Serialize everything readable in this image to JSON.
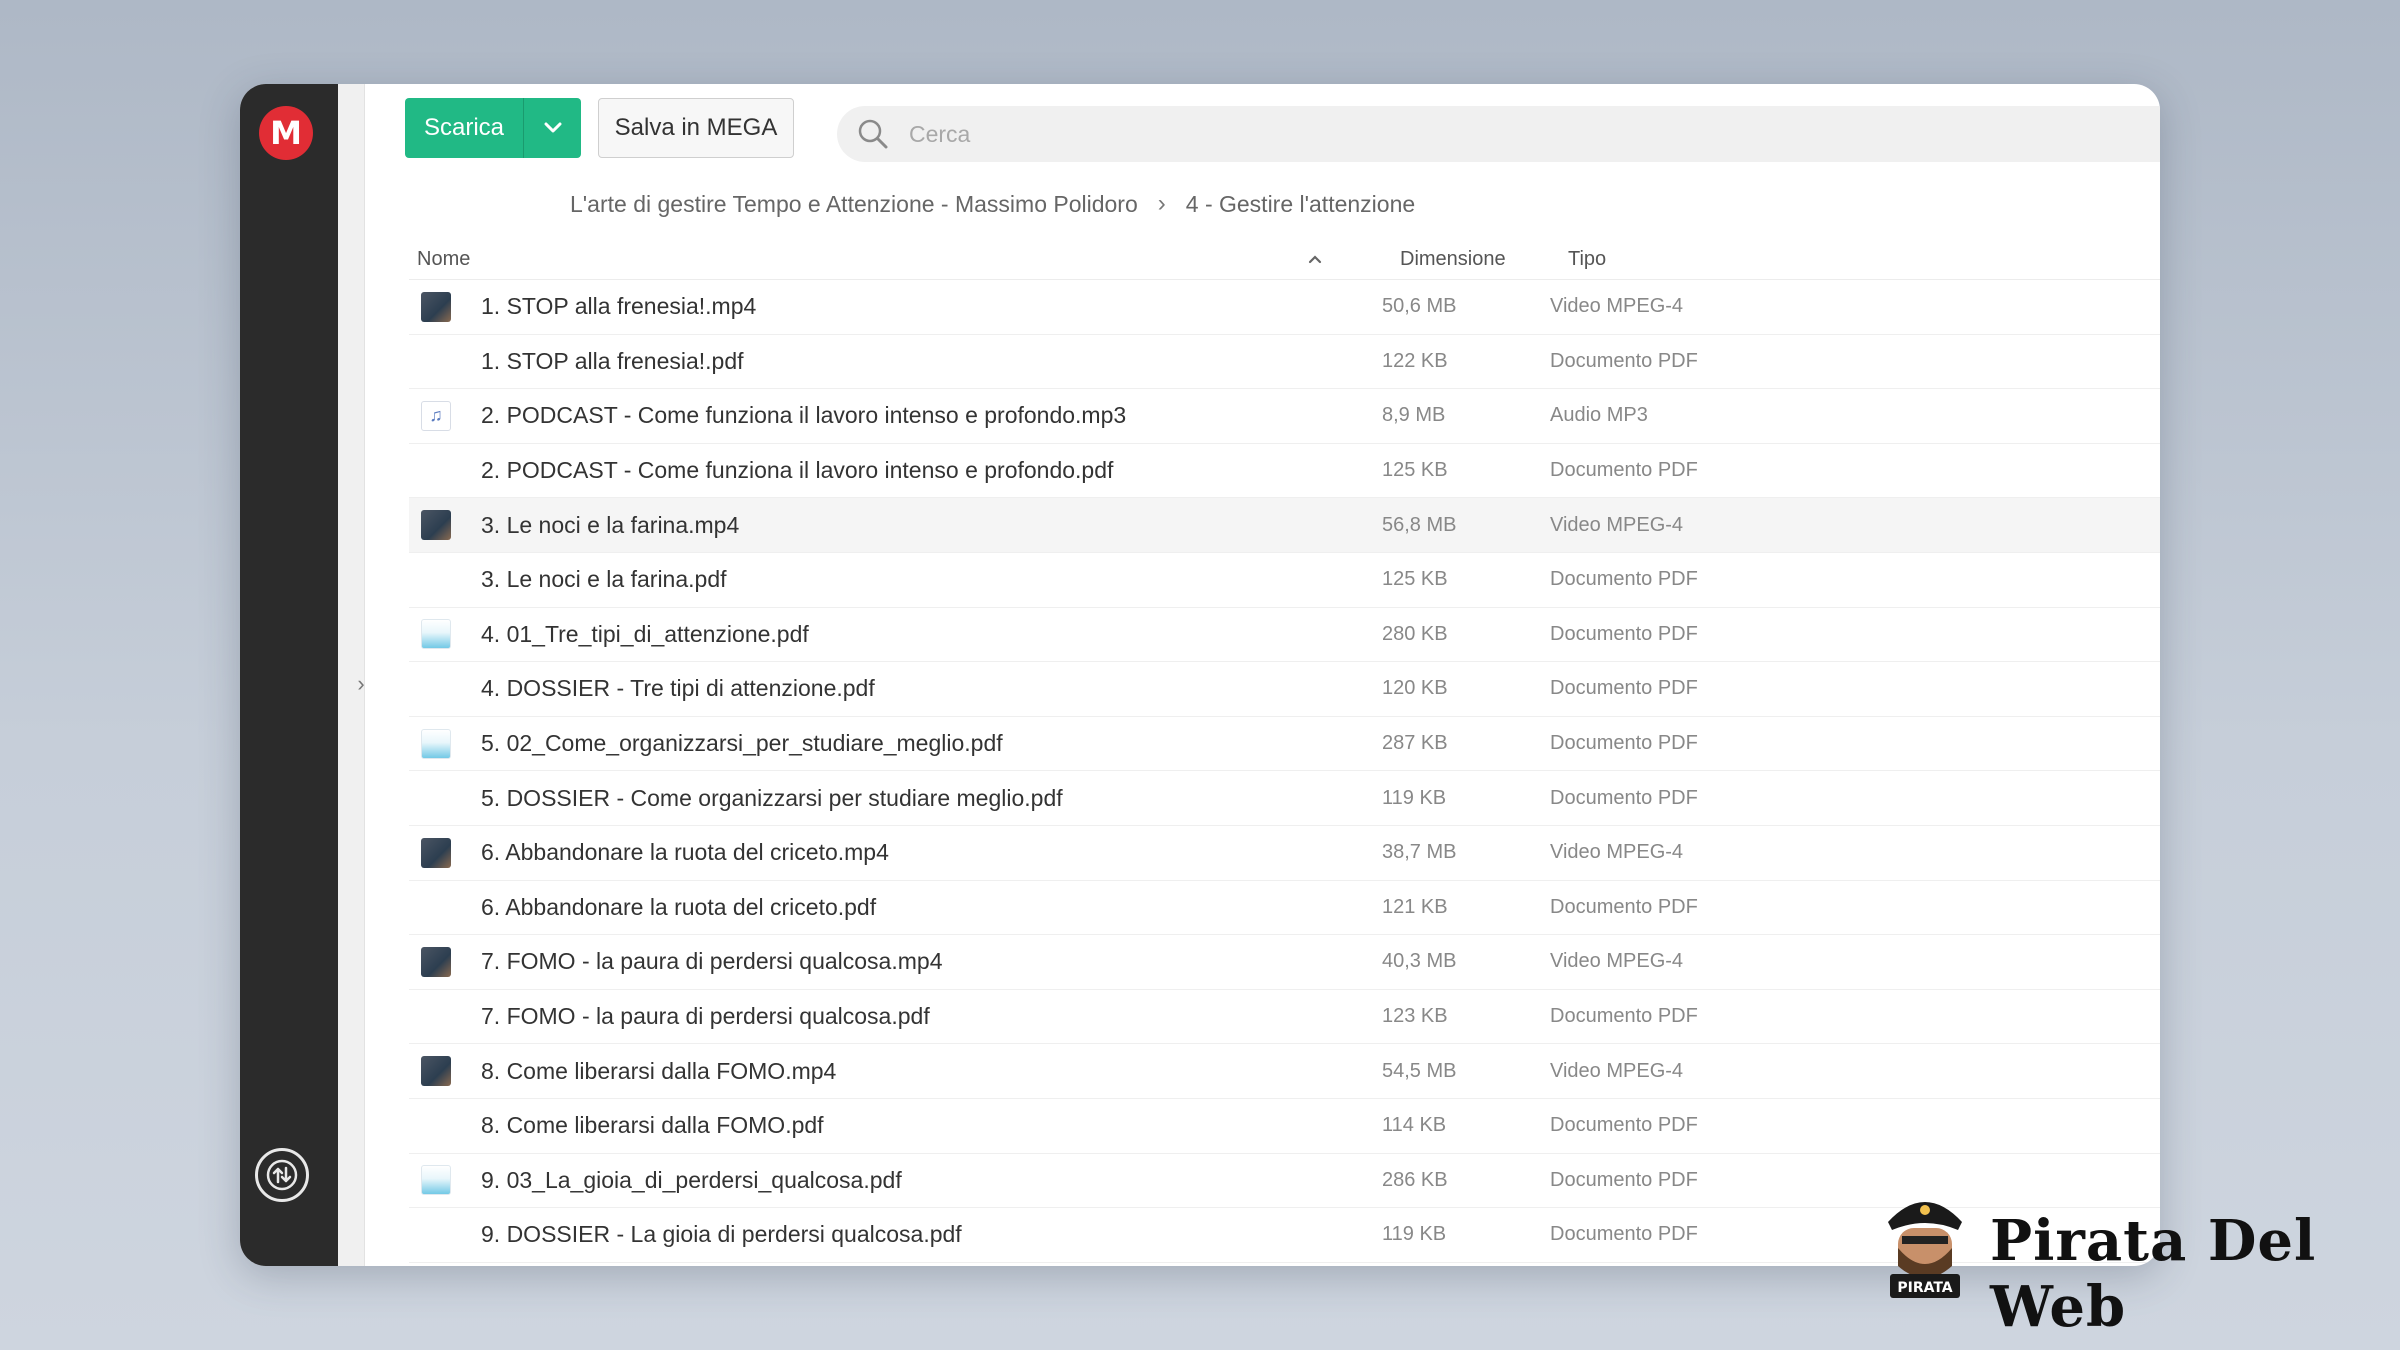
{
  "toolbar": {
    "download_label": "Scarica",
    "save_label": "Salva in MEGA",
    "search_placeholder": "Cerca"
  },
  "breadcrumb": {
    "parent": "L'arte di gestire Tempo e Attenzione - Massimo Polidoro",
    "current": "4 - Gestire l'attenzione"
  },
  "table": {
    "headers": {
      "name": "Nome",
      "size": "Dimensione",
      "type": "Tipo"
    },
    "rows": [
      {
        "name": "1. STOP alla frenesia!.mp4",
        "size": "50,6 MB",
        "type": "Video MPEG-4",
        "thumb": "video"
      },
      {
        "name": "1. STOP alla frenesia!.pdf",
        "size": "122 KB",
        "type": "Documento PDF",
        "thumb": "blank"
      },
      {
        "name": "2. PODCAST - Come funziona il lavoro intenso e profondo.mp3",
        "size": "8,9 MB",
        "type": "Audio MP3",
        "thumb": "audio"
      },
      {
        "name": "2. PODCAST - Come funziona il lavoro intenso e profondo.pdf",
        "size": "125 KB",
        "type": "Documento PDF",
        "thumb": "blank"
      },
      {
        "name": "3. Le noci e la farina.mp4",
        "size": "56,8 MB",
        "type": "Video MPEG-4",
        "thumb": "video"
      },
      {
        "name": "3. Le noci e la farina.pdf",
        "size": "125 KB",
        "type": "Documento PDF",
        "thumb": "blank"
      },
      {
        "name": "4. 01_Tre_tipi_di_attenzione.pdf",
        "size": "280 KB",
        "type": "Documento PDF",
        "thumb": "doc"
      },
      {
        "name": "4. DOSSIER - Tre tipi di attenzione.pdf",
        "size": "120 KB",
        "type": "Documento PDF",
        "thumb": "blank"
      },
      {
        "name": "5. 02_Come_organizzarsi_per_studiare_meglio.pdf",
        "size": "287 KB",
        "type": "Documento PDF",
        "thumb": "doc"
      },
      {
        "name": "5. DOSSIER - Come organizzarsi per studiare meglio.pdf",
        "size": "119 KB",
        "type": "Documento PDF",
        "thumb": "blank"
      },
      {
        "name": "6. Abbandonare la ruota del criceto.mp4",
        "size": "38,7 MB",
        "type": "Video MPEG-4",
        "thumb": "video"
      },
      {
        "name": "6. Abbandonare la ruota del criceto.pdf",
        "size": "121 KB",
        "type": "Documento PDF",
        "thumb": "blank"
      },
      {
        "name": "7. FOMO - la paura di perdersi qualcosa.mp4",
        "size": "40,3 MB",
        "type": "Video MPEG-4",
        "thumb": "video"
      },
      {
        "name": "7. FOMO - la paura di perdersi qualcosa.pdf",
        "size": "123 KB",
        "type": "Documento PDF",
        "thumb": "blank"
      },
      {
        "name": "8. Come liberarsi dalla FOMO.mp4",
        "size": "54,5 MB",
        "type": "Video MPEG-4",
        "thumb": "video"
      },
      {
        "name": "8. Come liberarsi dalla FOMO.pdf",
        "size": "114 KB",
        "type": "Documento PDF",
        "thumb": "blank"
      },
      {
        "name": "9. 03_La_gioia_di_perdersi_qualcosa.pdf",
        "size": "286 KB",
        "type": "Documento PDF",
        "thumb": "doc"
      },
      {
        "name": "9. DOSSIER - La gioia di perdersi qualcosa.pdf",
        "size": "119 KB",
        "type": "Documento PDF",
        "thumb": "blank"
      }
    ],
    "highlighted_row": 4
  },
  "watermark": {
    "brand_text": "Pirata Del Web",
    "badge_text": "PIRATA"
  },
  "colors": {
    "accent_green": "#21b985",
    "mega_red": "#e12d35",
    "rail_dark": "#2b2b2b"
  },
  "icons": {
    "logo": "mega-logo",
    "search": "search-icon",
    "chevron": "chevron-down-icon",
    "breadcrumb_sep": "chevron-right-icon",
    "sort": "sort-ascending-icon",
    "transfers": "transfer-icon"
  }
}
